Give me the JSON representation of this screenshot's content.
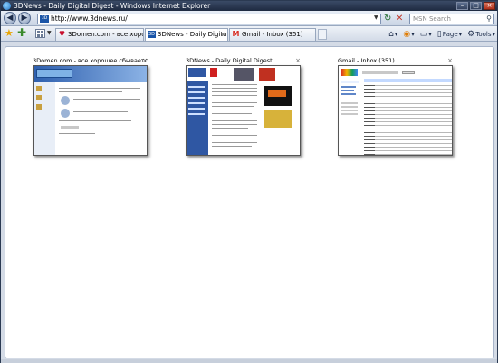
{
  "window": {
    "title": "3DNews - Daily Digital Digest - Windows Internet Explorer"
  },
  "address_bar": {
    "url": "http://www.3dnews.ru/",
    "favicon_text": "3D"
  },
  "search_box": {
    "placeholder": "MSN Search"
  },
  "tabs": [
    {
      "label": "3Domen.com - все хороше...",
      "icon": "heart-icon",
      "active": false
    },
    {
      "label": "3DNews - Daily Digital ...",
      "icon": "3dnews-icon",
      "active": true
    },
    {
      "label": "Gmail - Inbox (351)",
      "icon": "gmail-icon",
      "active": false
    }
  ],
  "toolbar": {
    "page_label": "Page",
    "tools_label": "Tools"
  },
  "quick_tabs": [
    {
      "title": "3Domen.com - все хорошее сбывается"
    },
    {
      "title": "3DNews - Daily Digital Digest"
    },
    {
      "title": "Gmail - Inbox (351)"
    }
  ],
  "colors": {
    "titlebar": "#1e2a40",
    "chrome": "#d4dbe6",
    "accent_blue": "#2f57a3",
    "gmail_red": "#d93025"
  }
}
